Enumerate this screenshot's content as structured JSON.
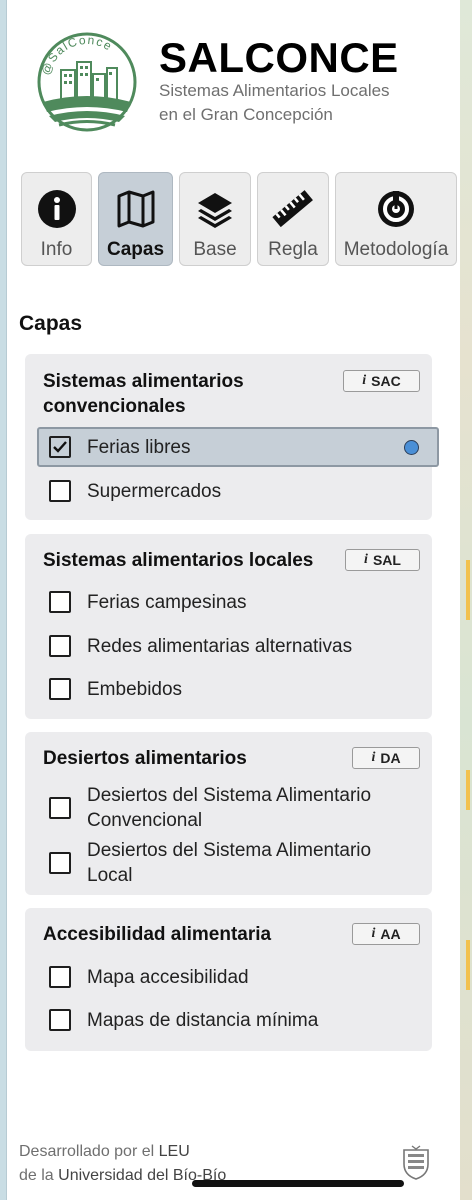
{
  "header": {
    "logo_text": "@SalConce",
    "title": "SALCONCE",
    "subtitle_line1": "Sistemas Alimentarios Locales",
    "subtitle_line2": "en el Gran Concepción"
  },
  "tabs": [
    {
      "label": "Info",
      "icon": "info-icon",
      "active": false
    },
    {
      "label": "Capas",
      "icon": "map-icon",
      "active": true
    },
    {
      "label": "Base",
      "icon": "layers-icon",
      "active": false
    },
    {
      "label": "Regla",
      "icon": "ruler-icon",
      "active": false
    },
    {
      "label": "Metodología",
      "icon": "methodology-icon",
      "active": false
    }
  ],
  "section_title": "Capas",
  "groups": [
    {
      "title_line1": "Sistemas alimentarios",
      "title_line2": "convencionales",
      "badge_i": "i",
      "badge_code": "SAC",
      "layers": [
        {
          "label": "Ferias libres",
          "checked": true,
          "legend_color": "#4a8fd6"
        },
        {
          "label": "Supermercados",
          "checked": false
        }
      ]
    },
    {
      "title_line1": "Sistemas alimentarios locales",
      "badge_i": "i",
      "badge_code": "SAL",
      "layers": [
        {
          "label": "Ferias campesinas",
          "checked": false
        },
        {
          "label": "Redes alimentarias alternativas",
          "checked": false
        },
        {
          "label": "Embebidos",
          "checked": false
        }
      ]
    },
    {
      "title_line1": "Desiertos alimentarios",
      "badge_i": "i",
      "badge_code": "DA",
      "layers": [
        {
          "label_line1": "Desiertos del Sistema Alimentario",
          "label_line2": "Convencional",
          "checked": false
        },
        {
          "label_line1": "Desiertos del Sistema Alimentario",
          "label_line2": "Local",
          "checked": false
        }
      ]
    },
    {
      "title_line1": "Accesibilidad alimentaria",
      "badge_i": "i",
      "badge_code": "AA",
      "layers": [
        {
          "label": "Mapa accesibilidad",
          "checked": false
        },
        {
          "label": "Mapas de distancia mínima",
          "checked": false
        }
      ]
    }
  ],
  "footer": {
    "line1_prefix": "Desarrollado por el ",
    "line1_link": "LEU",
    "line2_prefix": "de la ",
    "line2_link": "Universidad del Bío-Bío"
  },
  "colors": {
    "active_tab": "#c6cfd7",
    "group_bg": "#ececee",
    "logo_green": "#4f8a5c",
    "legend_blue": "#4a8fd6"
  }
}
